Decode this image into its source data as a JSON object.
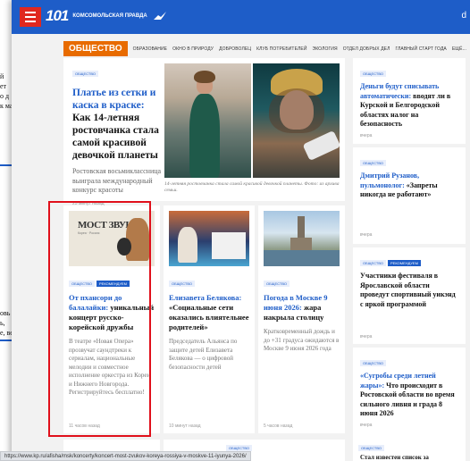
{
  "background_page": {
    "fragment_top": [
      "й",
      "ет",
      "о д",
      "к ма"
    ],
    "fragment_bottom": [
      "овь",
      "ь,",
      "е, ве"
    ]
  },
  "header": {
    "logo_number": "101",
    "logo_text_line1": "КОМСОМОЛЬСКАЯ",
    "logo_text_line2": "ПРАВДА",
    "right_text": "d",
    "brand_color": "#1e5dc8",
    "menu_color": "#e0281f"
  },
  "nav": {
    "active": "ОБЩЕСТВО",
    "items": [
      "ОБРАЗОВАНИЕ",
      "ОКНО В ПРИРОДУ",
      "ДОБРОВОЛЕЦ",
      "КЛУБ ПОТРЕБИТЕЛЕЙ",
      "ЭКОЛОГИЯ",
      "ОТДЕЛ ДОБРЫХ ДЕЛ",
      "ГЛАВНЫЙ СТАРТ ГОДА",
      "ЕЩЁ..."
    ],
    "accent_color": "#e86b00"
  },
  "feature": {
    "tag": "ОБЩЕСТВО",
    "title": "Платье из сетки и каска в краске:",
    "subtitle": "Как 14-летняя ростовчанка стала самой красивой девочкой планеты",
    "lead": "Ростовская восьмиклассница выиграла международный конкурс красоты",
    "time": "25 минут назад",
    "caption": "14-летняя ростовчанка стала самой красивой девочкой планеты. Фото: из архива семьи."
  },
  "right_column": [
    {
      "tags": [
        "ОБЩЕСТВО"
      ],
      "title": "Деньги будут списывать автоматически: вводят ли в Курской и Белгородской областях налог на безопасность",
      "highlight": "Деньги будут списывать автоматически:",
      "time": "вчера"
    },
    {
      "tags": [
        "ОБЩЕСТВО"
      ],
      "title": "Дмитрий Рузанов, пульмонолог: «Запреты никогда не работают»",
      "highlight": "Дмитрий Рузанов, пульмонолог:",
      "time": "вчера"
    },
    {
      "tags": [
        "ОБЩЕСТВО",
        "РЕКОМЕНДУЕМ"
      ],
      "title": "Участники фестиваля в Ярославской области проведут спортивный уикэнд с яркой программой",
      "highlight": "",
      "time": "вчера"
    },
    {
      "tags": [
        "ОБЩЕСТВО"
      ],
      "title": "«Сугробы среди летней жары»: Что происходит в Ростовской области во время сильного ливня и града 8 июня 2026",
      "highlight": "«Сугробы среди летней жары»:",
      "time": "вчера"
    }
  ],
  "cards": [
    {
      "tags": [
        "ОБЩЕСТВО",
        "РЕКОМЕНДУЕМ"
      ],
      "poster_title": "МОСТ ЗВУКОВ",
      "poster_sub": "Корея · Россия",
      "title_hl": "От пхансори до балалайки:",
      "title": "уникальный концерт русско-корейской дружбы",
      "lead": "В театре «Новая Опера» прозвучат саундтреки к сериалам, национальные мелодии и совместное исполнение оркестра из Кореи и Нижнего Новгорода. Регистрируйтесь бесплатно!",
      "time": "11 часов назад"
    },
    {
      "tags": [
        "ОБЩЕСТВО"
      ],
      "title_hl": "Елизавета Белякова:",
      "title": "«Социальные сети оказались влиятельнее родителей»",
      "lead": "Председатель Альянса по защите детей Елизавета Белякова — о цифровой безопасности детей",
      "time": "10 минут назад"
    },
    {
      "tags": [
        "ОБЩЕСТВО"
      ],
      "title_hl": "Погода в Москве 9 июня 2026:",
      "title": "жара накрыла столицу",
      "lead": "Кратковременный дождь и до +31 градуса ожидаются в Москве 9 июня 2026 года",
      "time": "5 часов назад"
    }
  ],
  "peek": {
    "tag_mid": "ОБЩЕСТВО",
    "tag_right": "ОБЩЕСТВО",
    "text_right": "Стал известен список за"
  },
  "status_url": "https://www.kp.ru/afisha/msk/koncerty/koncert-most-zvukov-koreya-rossiya-v-moskve-11-iyunya-2026/"
}
